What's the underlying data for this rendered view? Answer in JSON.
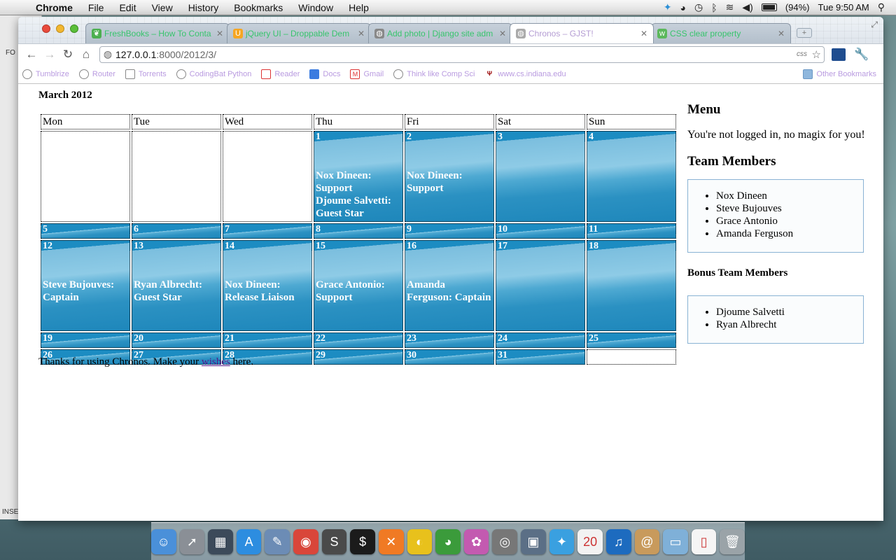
{
  "menubar": {
    "app": "Chrome",
    "items": [
      "File",
      "Edit",
      "View",
      "History",
      "Bookmarks",
      "Window",
      "Help"
    ],
    "battery": "(94%)",
    "clock": "Tue 9:50 AM"
  },
  "behind_window": {
    "label_top": "FO",
    "label_bottom": "INSE"
  },
  "tabs": [
    {
      "label": "FreshBooks – How To Conta",
      "icon": "leaf-icon",
      "color": "#4caf50"
    },
    {
      "label": "jQuery UI – Droppable Dem",
      "icon": "jquery-icon",
      "color": "#f6a623"
    },
    {
      "label": "Add photo | Django site adm",
      "icon": "globe-icon",
      "color": "#777777"
    },
    {
      "label": "Chronos – GJST!",
      "icon": "globe-icon",
      "color": "#999999"
    },
    {
      "label": "CSS clear property",
      "icon": "w3-icon",
      "color": "#5cb85c"
    }
  ],
  "address": {
    "host": "127.0.0.1",
    "path": ":8000/2012/3/",
    "badge": "css"
  },
  "bookmarks": [
    {
      "label": "Tumblrize",
      "icon": "globe-icon"
    },
    {
      "label": "Router",
      "icon": "globe-icon"
    },
    {
      "label": "Torrents",
      "icon": "torrent-icon"
    },
    {
      "label": "CodingBat Python",
      "icon": "globe-icon"
    },
    {
      "label": "Reader",
      "icon": "reader-icon"
    },
    {
      "label": "Docs",
      "icon": "docs-icon"
    },
    {
      "label": "Gmail",
      "icon": "gmail-icon"
    },
    {
      "label": "Think like Comp Sci",
      "icon": "globe-icon"
    },
    {
      "label": "www.cs.indiana.edu",
      "icon": "indiana-icon"
    }
  ],
  "other_bookmarks": "Other Bookmarks",
  "calendar": {
    "title": "March 2012",
    "weekdays": [
      "Mon",
      "Tue",
      "Wed",
      "Thu",
      "Fri",
      "Sat",
      "Sun"
    ],
    "weeks": [
      {
        "tall": true,
        "cells": [
          null,
          null,
          null,
          {
            "day": "1",
            "events": [
              "Nox Dineen: Support",
              "Djoume Salvetti: Guest Star"
            ]
          },
          {
            "day": "2",
            "events": [
              "Nox Dineen: Support"
            ]
          },
          {
            "day": "3",
            "events": []
          },
          {
            "day": "4",
            "events": []
          }
        ]
      },
      {
        "tall": false,
        "cells": [
          {
            "day": "5",
            "events": []
          },
          {
            "day": "6",
            "events": []
          },
          {
            "day": "7",
            "events": []
          },
          {
            "day": "8",
            "events": []
          },
          {
            "day": "9",
            "events": []
          },
          {
            "day": "10",
            "events": []
          },
          {
            "day": "11",
            "events": []
          }
        ]
      },
      {
        "tall": true,
        "cells": [
          {
            "day": "12",
            "events": [
              "Steve Bujouves: Captain"
            ]
          },
          {
            "day": "13",
            "events": [
              "Ryan Albrecht: Guest Star"
            ]
          },
          {
            "day": "14",
            "events": [
              "Nox Dineen: Release Liaison"
            ]
          },
          {
            "day": "15",
            "events": [
              "Grace Antonio: Support"
            ]
          },
          {
            "day": "16",
            "events": [
              "Amanda Ferguson: Captain"
            ]
          },
          {
            "day": "17",
            "events": []
          },
          {
            "day": "18",
            "events": []
          }
        ]
      },
      {
        "tall": false,
        "cells": [
          {
            "day": "19",
            "events": []
          },
          {
            "day": "20",
            "events": []
          },
          {
            "day": "21",
            "events": []
          },
          {
            "day": "22",
            "events": []
          },
          {
            "day": "23",
            "events": []
          },
          {
            "day": "24",
            "events": []
          },
          {
            "day": "25",
            "events": []
          }
        ]
      },
      {
        "tall": false,
        "cells": [
          {
            "day": "26",
            "events": []
          },
          {
            "day": "27",
            "events": []
          },
          {
            "day": "28",
            "events": []
          },
          {
            "day": "29",
            "events": []
          },
          {
            "day": "30",
            "events": []
          },
          {
            "day": "31",
            "events": []
          },
          null
        ]
      }
    ]
  },
  "footer": {
    "before": "Thanks for using Chronos. Make your ",
    "link": "wishes",
    "after": " here."
  },
  "sidebar": {
    "menu_title": "Menu",
    "login_message": "You're not logged in, no magix for you!",
    "team_title": "Team Members",
    "team_members": [
      "Nox Dineen",
      "Steve Bujouves",
      "Grace Antonio",
      "Amanda Ferguson"
    ],
    "bonus_title": "Bonus Team Members",
    "bonus_members": [
      "Djoume Salvetti",
      "Ryan Albrecht"
    ]
  },
  "dock": [
    {
      "name": "finder-icon",
      "color": "#4a90d9",
      "glyph": "☺"
    },
    {
      "name": "launchpad-icon",
      "color": "#8a8f96",
      "glyph": "➚"
    },
    {
      "name": "mission-control-icon",
      "color": "#3c4a5a",
      "glyph": "▦"
    },
    {
      "name": "app-store-icon",
      "color": "#2d8de0",
      "glyph": "A"
    },
    {
      "name": "preview-icon",
      "color": "#6c8cb5",
      "glyph": "✎"
    },
    {
      "name": "chrome-icon",
      "color": "#d9463a",
      "glyph": "◉"
    },
    {
      "name": "sublime-icon",
      "color": "#4a4a4a",
      "glyph": "S"
    },
    {
      "name": "terminal-icon",
      "color": "#1b1b1b",
      "glyph": "$"
    },
    {
      "name": "xampp-icon",
      "color": "#f07a24",
      "glyph": "✕"
    },
    {
      "name": "cyberduck-icon",
      "color": "#e8c11c",
      "glyph": "◐"
    },
    {
      "name": "adium-icon",
      "color": "#3b9b3b",
      "glyph": "◕"
    },
    {
      "name": "pinwheel-icon",
      "color": "#c35ab0",
      "glyph": "✿"
    },
    {
      "name": "network-utility-icon",
      "color": "#777777",
      "glyph": "◎"
    },
    {
      "name": "iphoto-icon",
      "color": "#5b6f86",
      "glyph": "▣"
    },
    {
      "name": "twitter-icon",
      "color": "#3aa0e0",
      "glyph": "✦"
    },
    {
      "name": "calendar-icon",
      "color": "#f2f2f2",
      "glyph": "20"
    },
    {
      "name": "itunes-icon",
      "color": "#1d6bbf",
      "glyph": "♫"
    },
    {
      "name": "address-book-icon",
      "color": "#c89a5c",
      "glyph": "@"
    },
    {
      "name": "folder-icon",
      "color": "#7fb0d8",
      "glyph": "▭"
    },
    {
      "name": "document-icon",
      "color": "#f5f5f5",
      "glyph": "▯"
    },
    {
      "name": "trash-icon",
      "color": "#9aa3a8",
      "glyph": "🗑"
    }
  ]
}
